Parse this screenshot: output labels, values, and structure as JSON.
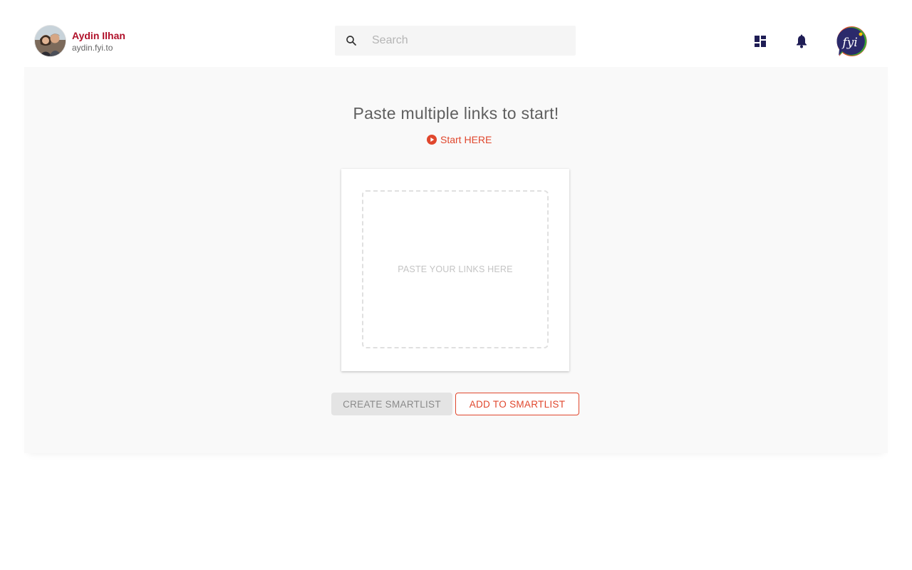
{
  "header": {
    "user": {
      "name": "Aydin Ilhan",
      "handle": "aydin.fyi.to",
      "avatar": "profile-photo"
    },
    "search": {
      "placeholder": "Search",
      "value": "",
      "icon": "search-icon"
    },
    "icons": {
      "dashboard": "dashboard-icon",
      "notifications": "bell-icon"
    },
    "logo": {
      "text": "fyi",
      "colors": {
        "bubble": "#2b2a6b",
        "accent_red": "#e0472d",
        "accent_green": "#3aaa35",
        "accent_yellow": "#f5c400"
      }
    }
  },
  "main": {
    "title": "Paste multiple links to start!",
    "start_link": {
      "label": "Start HERE",
      "icon": "play-circle-icon"
    },
    "paste_zone": {
      "placeholder": "PASTE YOUR LINKS HERE"
    },
    "actions": {
      "create_label": "CREATE SMARTLIST",
      "add_label": "ADD TO SMARTLIST"
    }
  },
  "colors": {
    "brand_red": "#e0472d",
    "name_red": "#b0112a",
    "icon_navy": "#1f1d55",
    "panel_bg": "#f9f9f9"
  }
}
